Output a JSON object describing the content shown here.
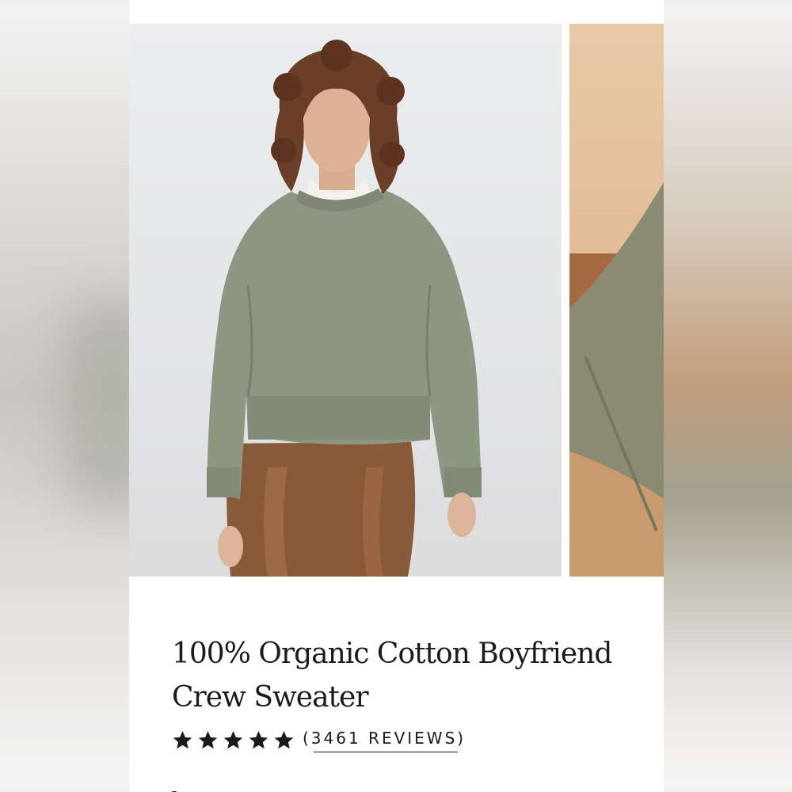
{
  "product": {
    "title_line1": "100% Organic Cotton Boyfriend",
    "title_line2": "Crew Sweater",
    "rating_stars": 5,
    "reviews_label": "(3461 REVIEWS)"
  },
  "colors": {
    "sweater": "#8b9683",
    "pants": "#8a5a38",
    "star": "#1b1b1b",
    "text": "#1b1b1b"
  },
  "icons": [
    "star-icon"
  ]
}
